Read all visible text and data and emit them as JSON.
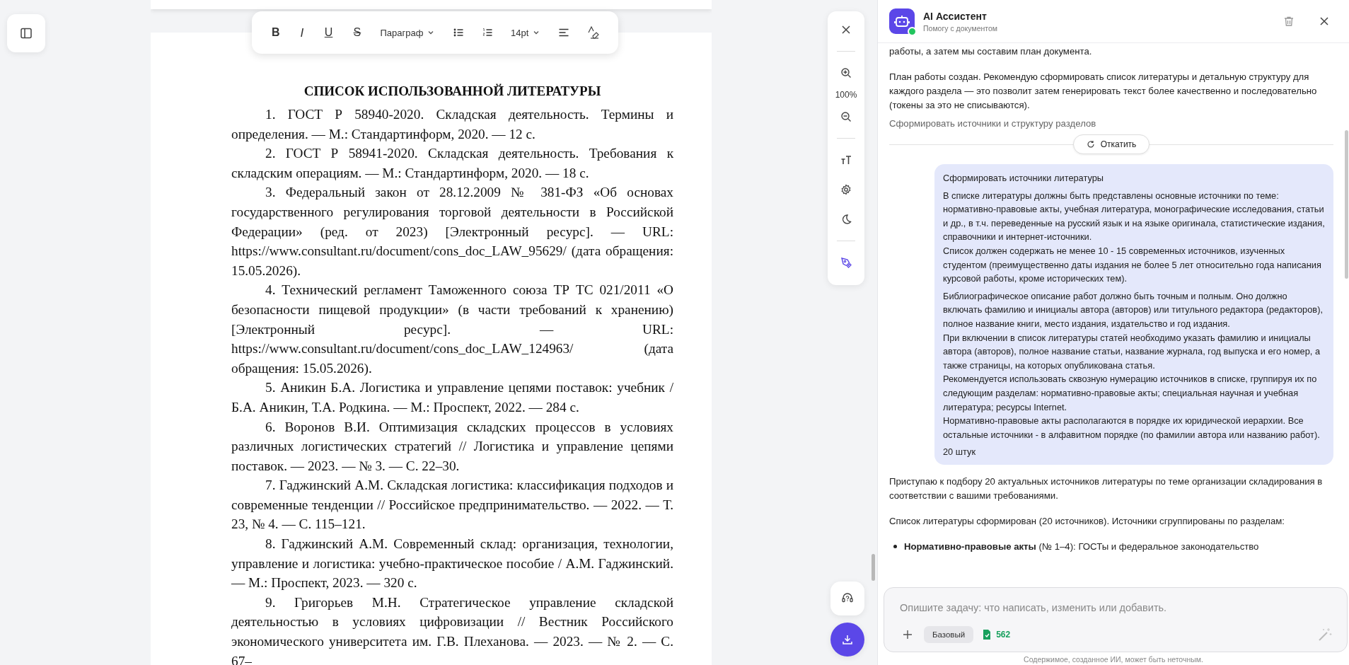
{
  "toolbar": {
    "items": [
      {
        "kind": "bold",
        "label": "B"
      },
      {
        "kind": "italic",
        "label": "I"
      },
      {
        "kind": "underline",
        "label": "U"
      },
      {
        "kind": "strike",
        "label": "S"
      },
      {
        "kind": "select",
        "label": "Параграф"
      },
      {
        "kind": "bullet-list"
      },
      {
        "kind": "numbered-list"
      },
      {
        "kind": "select",
        "label": "14pt"
      },
      {
        "kind": "align"
      },
      {
        "kind": "clear-format"
      }
    ]
  },
  "document": {
    "title": "СПИСОК ИСПОЛЬЗОВАННОЙ ЛИТЕРАТУРЫ",
    "entries": [
      "1. ГОСТ Р 58940-2020. Складская деятельность. Термины и определения. — М.: Стандартинформ, 2020. — 12 с.",
      "2. ГОСТ Р 58941-2020. Складская деятельность. Требования к складским операциям. — М.: Стандартинформ, 2020. — 18 с.",
      "3. Федеральный закон от 28.12.2009 № 381-ФЗ «Об основах государственного регулирования торговой деятельности в Российской Федерации» (ред. от 2023) [Электронный ресурс]. — URL: https://www.consultant.ru/document/cons_doc_LAW_95629/ (дата обращения: 15.05.2026).",
      "4. Технический регламент Таможенного союза ТР ТС 021/2011 «О безопасности пищевой продукции» (в части требований к хранению) [Электронный ресурс]. — URL: https://www.consultant.ru/document/cons_doc_LAW_124963/ (дата обращения: 15.05.2026).",
      "5. Аникин Б.А. Логистика и управление цепями поставок: учебник / Б.А. Аникин, Т.А. Родкина. — М.: Проспект, 2022. — 284 с.",
      "6. Воронов В.И. Оптимизация складских процессов в условиях различных логистических стратегий // Логистика и управление цепями поставок. — 2023. — № 3. — С. 22–30.",
      "7. Гаджинский А.М. Складская логистика: классификация подходов и современные тенденции // Российское предпринимательство. — 2022. — Т. 23, № 4. — С. 115–121.",
      "8. Гаджинский А.М. Современный склад: организация, технологии, управление и логистика: учебно-практическое пособие / А.М. Гаджинский. — М.: Проспект, 2023. — 320 с.",
      "9. Григорьев М.Н. Стратегическое управление складской деятельностью в условиях цифровизации // Вестник Российского экономического университета им. Г.В. Плеханова. — 2023. — № 2. — С. 67–"
    ]
  },
  "view_controls": {
    "zoom": "100%",
    "tools": [
      {
        "kind": "text-size",
        "selected": false
      },
      {
        "kind": "settings",
        "selected": false
      },
      {
        "kind": "theme",
        "selected": false
      },
      {
        "kind": "pen",
        "selected": true
      }
    ]
  },
  "assistant": {
    "title": "AI Ассистент",
    "subtitle": "Помогу с документом",
    "online": true,
    "messages": [
      {
        "kind": "text",
        "text": "работы, а затем мы составим план документа."
      },
      {
        "kind": "text",
        "text": "План работы создан. Рекомендую сформировать список литературы и детальную структуру для каждого раздела — это позволит затем генерировать текст более качественно и последовательно (токены за это не списываются)."
      },
      {
        "kind": "suggestion",
        "text": "Сформировать источники и структуру разделов"
      },
      {
        "kind": "rollback",
        "text": "Откатить"
      },
      {
        "kind": "user",
        "title": "Сформировать источники литературы",
        "paragraphs": [
          [
            "В списке литературы должны быть представлены основные источники по теме: нормативно-правовые акты, учебная литература, монографические исследования, статьи и др., в т.ч. переведенные на русский язык и на языке оригинала, статистические издания, справочники и интернет-источники.",
            "Список должен содержать не менее 10 - 15 современных источников, изученных студентом (преимущественно даты издания не более 5 лет относительно года написания курсовой работы, кроме исторических тем)."
          ],
          [
            "Библиографическое описание работ должно быть точным и полным. Оно должно включать фамилию и инициалы автора (авторов) или титульного редактора (редакторов), полное название книги, место издания, издательство и год издания.",
            "При включении в список литературы статей необходимо указать фамилию и инициалы автора (авторов), полное название статьи, название журнала, год выпуска и его номер, а также страницы, на которых опубликована статья.",
            "Рекомендуется использовать сквозную нумерацию источников в списке, группируя их по следующим разделам: нормативно-правовые акты; специальная научная и учебная литература; ресурсы Internet.",
            "Нормативно-правовые акты располагаются в порядке их юридической иерархии. Все остальные источники - в алфавитном порядке (по фамилии автора или названию работ)."
          ],
          [
            "20 штук"
          ]
        ]
      },
      {
        "kind": "text",
        "text": "Приступаю к подбору 20 актуальных источников литературы по теме организации складирования в соответствии с вашими требованиями."
      },
      {
        "kind": "text",
        "text": "Список литературы сформирован (20 источников). Источники сгруппированы по разделам:"
      },
      {
        "kind": "bullet",
        "text": "**Нормативно-правовые акты** (№ 1–4): ГОСТы и федеральное законодательство"
      }
    ],
    "input": {
      "placeholder": "Опишите задачу: что написать, изменить или добавить.",
      "mode": "Базовый",
      "tokens": "562"
    },
    "disclaimer": "Содержимое, созданное ИИ, может быть неточным."
  }
}
